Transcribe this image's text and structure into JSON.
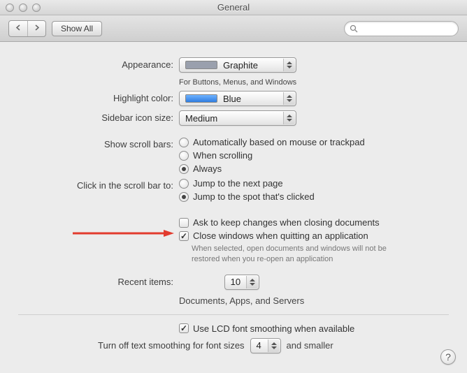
{
  "window": {
    "title": "General"
  },
  "toolbar": {
    "show_all": "Show All",
    "search_placeholder": ""
  },
  "appearance": {
    "label": "Appearance:",
    "value": "Graphite",
    "suffix": "For Buttons, Menus, and Windows"
  },
  "highlight": {
    "label": "Highlight color:",
    "value": "Blue"
  },
  "sidebar_size": {
    "label": "Sidebar icon size:",
    "value": "Medium"
  },
  "scroll_bars": {
    "label": "Show scroll bars:",
    "options": {
      "auto": "Automatically based on mouse or trackpad",
      "scrolling": "When scrolling",
      "always": "Always"
    },
    "selected": "always"
  },
  "scroll_click": {
    "label": "Click in the scroll bar to:",
    "options": {
      "next_page": "Jump to the next page",
      "jump_spot": "Jump to the spot that's clicked"
    },
    "selected": "jump_spot"
  },
  "documents": {
    "ask_keep": {
      "label": "Ask to keep changes when closing documents",
      "checked": false
    },
    "close_windows": {
      "label": "Close windows when quitting an application",
      "checked": true,
      "note": "When selected, open documents and windows will not be restored when you re-open an application"
    }
  },
  "recent": {
    "label": "Recent items:",
    "value": "10",
    "suffix": "Documents, Apps, and Servers"
  },
  "font_smoothing": {
    "lcd": {
      "label": "Use LCD font smoothing when available",
      "checked": true
    },
    "turn_off_prefix": "Turn off text smoothing for font sizes",
    "value": "4",
    "turn_off_suffix": "and smaller"
  },
  "help": "?"
}
